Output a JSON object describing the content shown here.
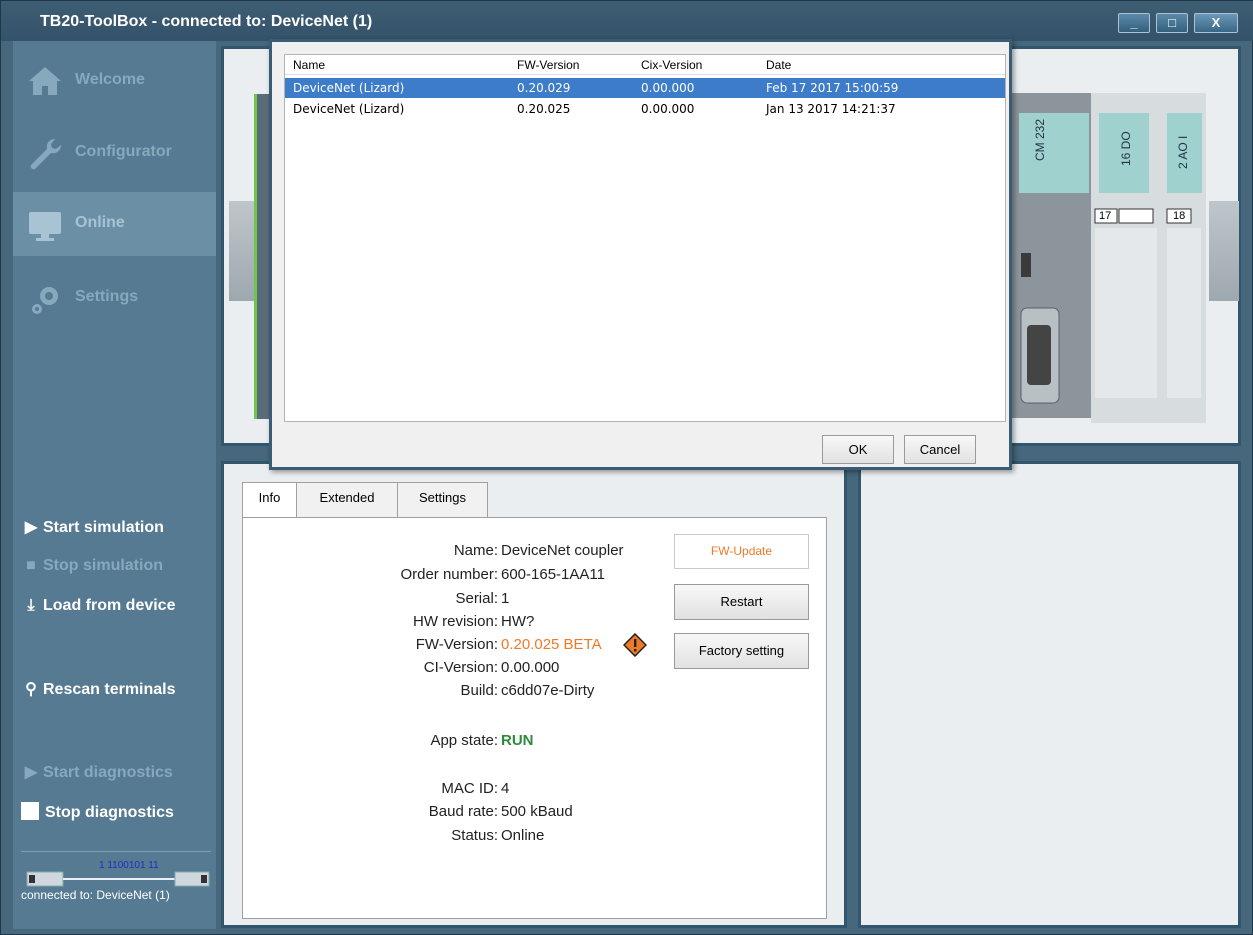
{
  "window": {
    "title": "TB20-ToolBox - connected to: DeviceNet (1)",
    "controls": [
      "_",
      "□",
      "X"
    ]
  },
  "sidebar": {
    "nav": [
      {
        "label": "Welcome",
        "icon": "home-icon"
      },
      {
        "label": "Configurator",
        "icon": "wrench-icon"
      },
      {
        "label": "Online",
        "icon": "monitor-icon"
      },
      {
        "label": "Settings",
        "icon": "gears-icon"
      }
    ],
    "actions": {
      "start_simulation": "Start simulation",
      "stop_simulation": "Stop simulation",
      "load_from_device": "Load from device",
      "rescan_terminals": "Rescan terminals",
      "start_diagnostics": "Start diagnostics",
      "stop_diagnostics": "Stop diagnostics"
    },
    "usb_bits": "1 1100101 11",
    "status": "connected to: DeviceNet (1)"
  },
  "dialog": {
    "columns": [
      "Name",
      "FW-Version",
      "Cix-Version",
      "Date"
    ],
    "rows": [
      {
        "name": "DeviceNet (Lizard)",
        "fw": "0.20.029",
        "cix": "0.00.000",
        "date": "Feb 17 2017 15:00:59"
      },
      {
        "name": "DeviceNet (Lizard)",
        "fw": "0.20.025",
        "cix": "0.00.000",
        "date": "Jan 13 2017 14:21:37"
      }
    ],
    "ok": "OK",
    "cancel": "Cancel"
  },
  "tabs": [
    "Info",
    "Extended",
    "Settings"
  ],
  "info": {
    "fields": [
      {
        "key": "Name:",
        "value": "DeviceNet coupler"
      },
      {
        "key": "Order number:",
        "value": "600-165-1AA11"
      },
      {
        "key": "Serial:",
        "value": "1"
      },
      {
        "key": "HW revision:",
        "value": "HW?"
      },
      {
        "key": "FW-Version:",
        "value": "0.20.025 BETA"
      },
      {
        "key": "CI-Version:",
        "value": "0.00.000"
      },
      {
        "key": "Build:",
        "value": "c6dd07e-Dirty"
      }
    ],
    "app_state_key": "App state:",
    "app_state_value": "RUN",
    "net_fields": [
      {
        "key": "MAC ID:",
        "value": "4"
      },
      {
        "key": "Baud rate:",
        "value": "500 kBaud"
      },
      {
        "key": "Status:",
        "value": "Online"
      }
    ],
    "buttons": {
      "fw_update": "FW-Update",
      "restart": "Restart",
      "factory": "Factory setting"
    }
  },
  "rack": {
    "modules": [
      "CM 232",
      "16 DO",
      "2 AO I"
    ],
    "slot_numbers": [
      "17",
      "18"
    ]
  },
  "colors": {
    "accent_orange": "#ee7a28",
    "run_green": "#2e8b3a",
    "selection_blue": "#3d7cc9",
    "sidebar_bg": "#557a91"
  }
}
